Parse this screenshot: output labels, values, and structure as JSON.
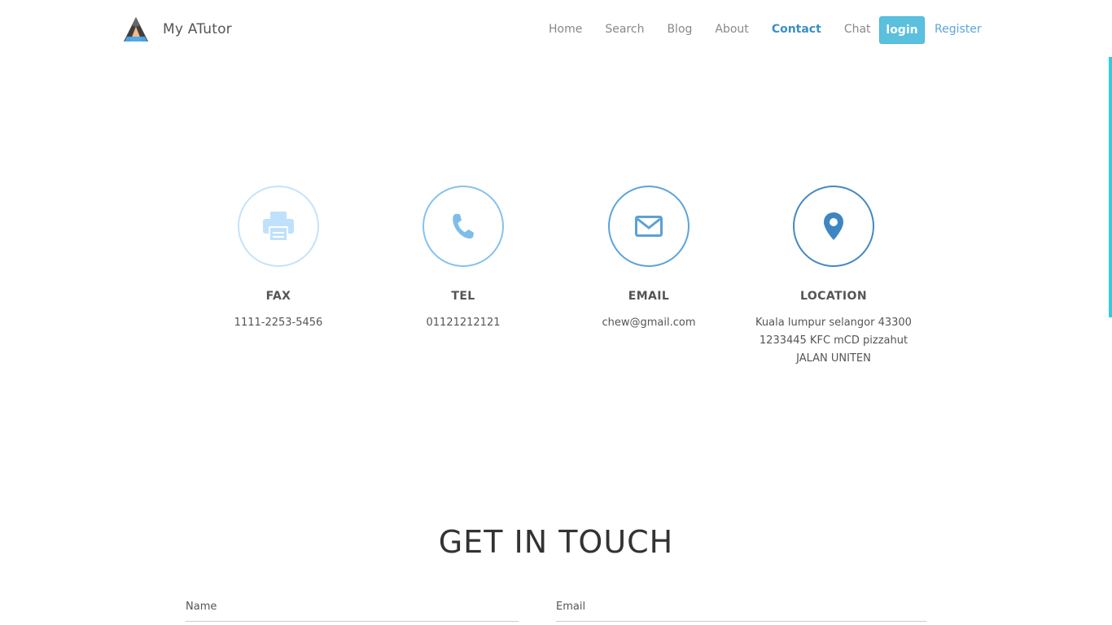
{
  "brand": {
    "name": "My ATutor"
  },
  "nav": {
    "items": [
      {
        "label": "Home"
      },
      {
        "label": "Search"
      },
      {
        "label": "Blog"
      },
      {
        "label": "About"
      },
      {
        "label": "Contact",
        "active": true
      },
      {
        "label": "Chat"
      }
    ],
    "login_label": "login",
    "register_label": "Register"
  },
  "contact": [
    {
      "icon": "printer-icon",
      "title": "FAX",
      "value": "1111-2253-5456",
      "color": "#bfe1fb"
    },
    {
      "icon": "phone-icon",
      "title": "TEL",
      "value": "01121212121",
      "color": "#7fbde9"
    },
    {
      "icon": "envelope-icon",
      "title": "EMAIL",
      "value": "chew@gmail.com",
      "color": "#5ba1d8"
    },
    {
      "icon": "map-marker-icon",
      "title": "LOCATION",
      "value": "Kuala lumpur selangor 43300 1233445 KFC mCD pizzahut JALAN UNITEN",
      "color": "#3d86c3"
    }
  ],
  "get_in_touch": {
    "title": "GET IN TOUCH",
    "name_label": "Name",
    "email_label": "Email"
  },
  "colors": {
    "accent": "#3c8ec8",
    "login_button": "#5bc0de",
    "scroll_indicator": "#2dcde4"
  }
}
